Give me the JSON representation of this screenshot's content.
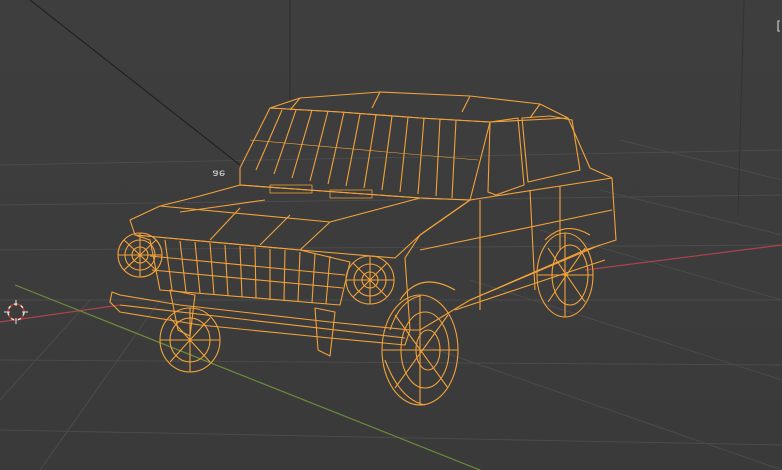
{
  "app": {
    "view": "3D Viewport",
    "shading": "wireframe"
  },
  "scene": {
    "object_name_label": "ǝɐ",
    "selected_object_color": "#f5a33a",
    "grid_color": "#4a4a4a",
    "x_axis_color": "#b0434a",
    "y_axis_color": "#6b8f3a",
    "background_color": "#3d3d3d",
    "cursor_icon": "3d-cursor-icon"
  },
  "overlay": {
    "corner_glyph": "["
  }
}
